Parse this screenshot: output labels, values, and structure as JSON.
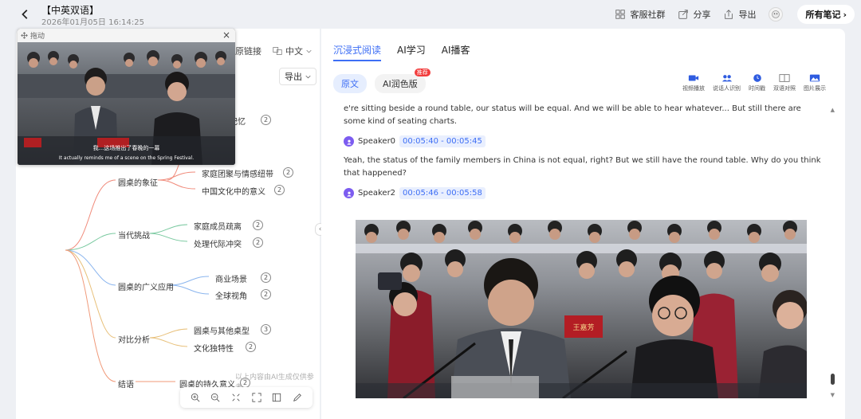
{
  "header": {
    "title": "【中英双语】",
    "timestamp": "2026年01月05日 16:14:25",
    "actions": [
      {
        "label": "客服社群",
        "icon": "grid-icon"
      },
      {
        "label": "分享",
        "icon": "share-icon"
      },
      {
        "label": "导出",
        "icon": "export-icon"
      }
    ],
    "all_notes": "所有笔记",
    "all_notes_chevron": "›"
  },
  "left": {
    "toolbar": {
      "original_link": "原链接",
      "language": "中文",
      "export": "导出"
    },
    "mindmap": {
      "partial_node": "记忆",
      "partial_count": "2",
      "branches": [
        {
          "label": "圆桌的象征",
          "children": [
            {
              "label": "家庭团聚与情感纽带",
              "count": "2"
            },
            {
              "label": "中国文化中的意义",
              "count": "2"
            }
          ]
        },
        {
          "label": "当代挑战",
          "children": [
            {
              "label": "家庭成员疏离",
              "count": "2"
            },
            {
              "label": "处理代际冲突",
              "count": "2"
            }
          ]
        },
        {
          "label": "圆桌的广义应用",
          "children": [
            {
              "label": "商业场景",
              "count": "2"
            },
            {
              "label": "全球视角",
              "count": "2"
            }
          ]
        },
        {
          "label": "对比分析",
          "children": [
            {
              "label": "圆桌与其他桌型",
              "count": "3"
            },
            {
              "label": "文化独特性",
              "count": "2"
            }
          ]
        },
        {
          "label": "结语",
          "children": [
            {
              "label": "圆桌的持久意义",
              "count": "2"
            }
          ]
        }
      ]
    },
    "ai_note": "以上内容由AI生成仅供参考"
  },
  "float_video": {
    "drag_label": "拖动",
    "subtitle_cn": "我...这场推出了春晚的一幕",
    "subtitle_en": "It actually reminds me of a scene on the Spring Festival."
  },
  "right": {
    "tabs": [
      "沉浸式阅读",
      "AI学习",
      "AI播客"
    ],
    "subtabs": [
      "原文",
      "AI润色版"
    ],
    "badge": "推荐",
    "view_icons": [
      {
        "label": "视频播放",
        "icon": "video-icon"
      },
      {
        "label": "说话人识别",
        "icon": "speakers-icon"
      },
      {
        "label": "时间戳",
        "icon": "clock-icon"
      },
      {
        "label": "双语对照",
        "icon": "bilingual-icon"
      },
      {
        "label": "图片展示",
        "icon": "image-icon"
      }
    ],
    "transcript": {
      "para1": "e're sitting beside a round table, our status will be equal. And we will be able to hear whatever... But still there are some kind of seating charts.",
      "seg1": {
        "speaker": "Speaker0",
        "time": "00:05:40 - 00:05:45",
        "text": "Yeah, the status of the family members in China is not equal, right? But we still have the round table. Why do you think that happened?"
      },
      "seg2": {
        "speaker": "Speaker2",
        "time": "00:05:46 - 00:05:58"
      }
    },
    "photo_nameplate": "王嘉芳"
  },
  "colors": {
    "accent": "#3d6ef5",
    "badge": "#f23c3c",
    "speaker_avatar": "#7c5cf0",
    "branch_colors": [
      "#f08a7a",
      "#7ac9a0",
      "#8ab5ee",
      "#e8c07a",
      "#f09a7a"
    ]
  }
}
